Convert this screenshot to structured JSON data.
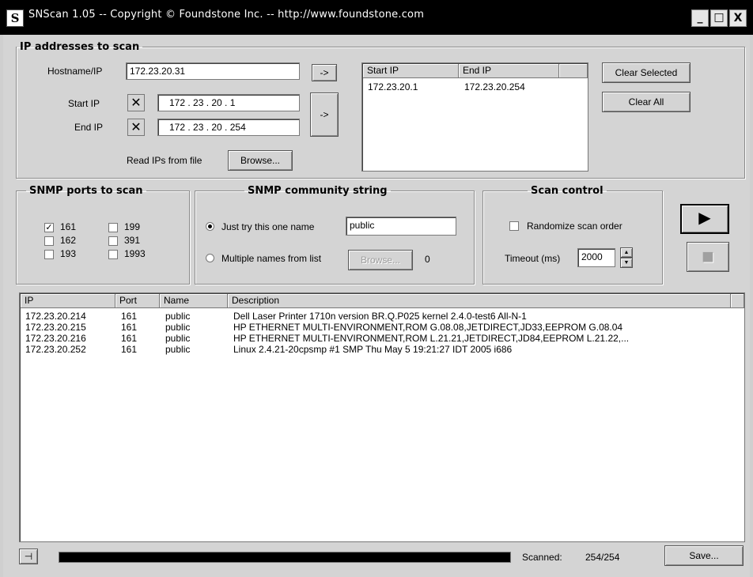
{
  "window": {
    "title": "SNScan 1.05 -- Copyright © Foundstone Inc. -- http://www.foundstone.com",
    "icon_letter": "S",
    "min_glyph": "_",
    "max_glyph": "□",
    "close_glyph": "X"
  },
  "ip_group": {
    "title": "IP addresses to scan",
    "hostname_label": "Hostname/IP",
    "hostname_value": "172.23.20.31",
    "start_ip_label": "Start IP",
    "start_ip_value": "172 .  23  .  20  .  1",
    "end_ip_label": "End IP",
    "end_ip_value": "172 .  23  .  20  .  254",
    "clear_glyph": "✕",
    "add_host_button": "->",
    "add_range_button": "->",
    "read_file_label": "Read IPs from file",
    "browse_button": "Browse...",
    "range_columns": [
      "Start IP",
      "End IP"
    ],
    "ranges": [
      {
        "start": "172.23.20.1",
        "end": "172.23.20.254"
      }
    ],
    "clear_selected_button": "Clear Selected",
    "clear_all_button": "Clear All"
  },
  "snmp_ports": {
    "title": "SNMP ports to scan",
    "ports": [
      {
        "label": "161",
        "checked": true
      },
      {
        "label": "199",
        "checked": false
      },
      {
        "label": "162",
        "checked": false
      },
      {
        "label": "391",
        "checked": false
      },
      {
        "label": "193",
        "checked": false
      },
      {
        "label": "1993",
        "checked": false
      }
    ],
    "check_mark": "✓"
  },
  "community": {
    "title": "SNMP community string",
    "single_option": "Just try this one name",
    "single_value": "public",
    "multi_option": "Multiple names from list",
    "multi_browse": "Browse...",
    "multi_count": "0",
    "selected": "single"
  },
  "scan_control": {
    "title": "Scan control",
    "randomize_label": "Randomize scan order",
    "randomize_checked": false,
    "timeout_label": "Timeout (ms)",
    "timeout_value": "2000",
    "spin_up": "▲",
    "spin_down": "▼",
    "start_glyph": "▶",
    "stop_glyph": "■"
  },
  "results": {
    "columns": [
      "IP",
      "Port",
      "Name",
      "Description"
    ],
    "rows": [
      [
        "172.23.20.214",
        "161",
        "public",
        "Dell Laser Printer 1710n version BR.Q.P025 kernel 2.4.0-test6 All-N-1"
      ],
      [
        "172.23.20.215",
        "161",
        "public",
        "HP ETHERNET MULTI-ENVIRONMENT,ROM G.08.08,JETDIRECT,JD33,EEPROM G.08.04"
      ],
      [
        "172.23.20.216",
        "161",
        "public",
        "HP ETHERNET MULTI-ENVIRONMENT,ROM L.21.21,JETDIRECT,JD84,EEPROM L.21.22,..."
      ],
      [
        "172.23.20.252",
        "161",
        "public",
        "Linux 2.4.21-20cpsmp #1 SMP Thu May 5 19:21:27 IDT 2005 i686"
      ]
    ]
  },
  "status": {
    "pin_glyph": "⊣",
    "progress": 1.0,
    "scanned_label": "Scanned:",
    "scanned_value": "254/254",
    "save_button": "Save..."
  },
  "colors": {
    "titlebar": "#000000",
    "face": "#d4d4d4",
    "progress_fill": "#000000"
  }
}
